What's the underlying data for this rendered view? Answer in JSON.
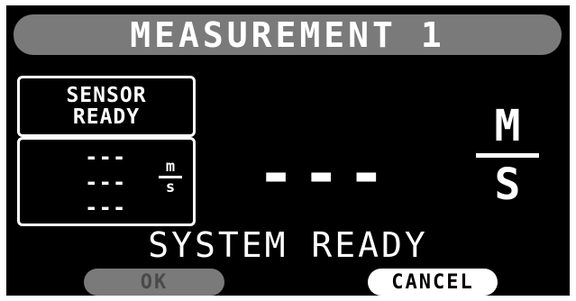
{
  "title": "MEASUREMENT 1",
  "sensor": {
    "line1": "SENSOR",
    "line2": "READY"
  },
  "readings": {
    "row1": "---",
    "row2": "---",
    "row3": "---"
  },
  "small_unit": {
    "numerator": "m",
    "denominator": "s"
  },
  "main_reading": "---",
  "main_unit": {
    "numerator": "M",
    "denominator": "S"
  },
  "status": "SYSTEM READY",
  "buttons": {
    "ok": "OK",
    "cancel": "CANCEL"
  },
  "colors": {
    "background": "#000000",
    "text": "#ffffff",
    "disabled": "#7a7a7a",
    "frame": "#ffffff"
  }
}
